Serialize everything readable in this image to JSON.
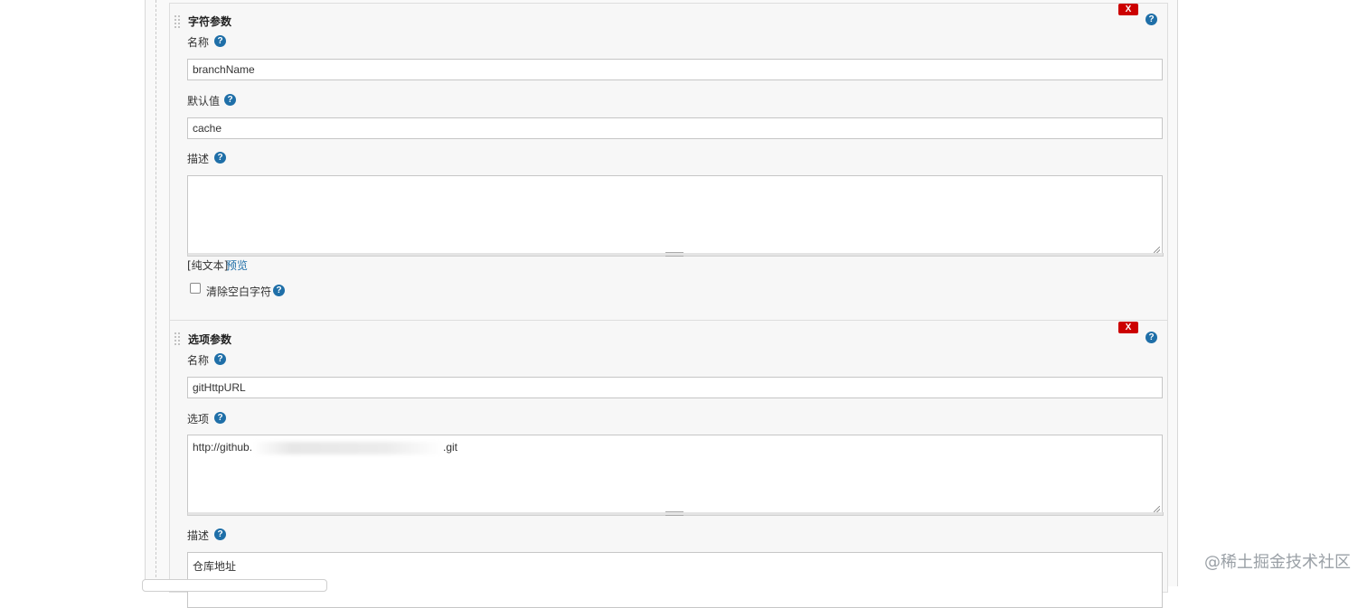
{
  "string_param": {
    "title": "字符参数",
    "delete_label": "X",
    "name_label": "名称",
    "name_value": "branchName",
    "default_label": "默认值",
    "default_value": "cache",
    "desc_label": "描述",
    "desc_value": "",
    "plain_text_label": "[纯文本]",
    "preview_label": "预览",
    "trim_label": "清除空白字符",
    "trim_checked": false
  },
  "choice_param": {
    "title": "选项参数",
    "delete_label": "X",
    "name_label": "名称",
    "name_value": "gitHttpURL",
    "choices_label": "选项",
    "choices_prefix": "http://github.",
    "choices_suffix": ".git",
    "desc_label": "描述",
    "desc_value": "仓库地址"
  },
  "help_glyph": "?",
  "watermark": "@稀土掘金技术社区",
  "colors": {
    "help_icon": "#1f6fa8",
    "delete_button": "#cc0000",
    "link": "#1f6fa8"
  }
}
